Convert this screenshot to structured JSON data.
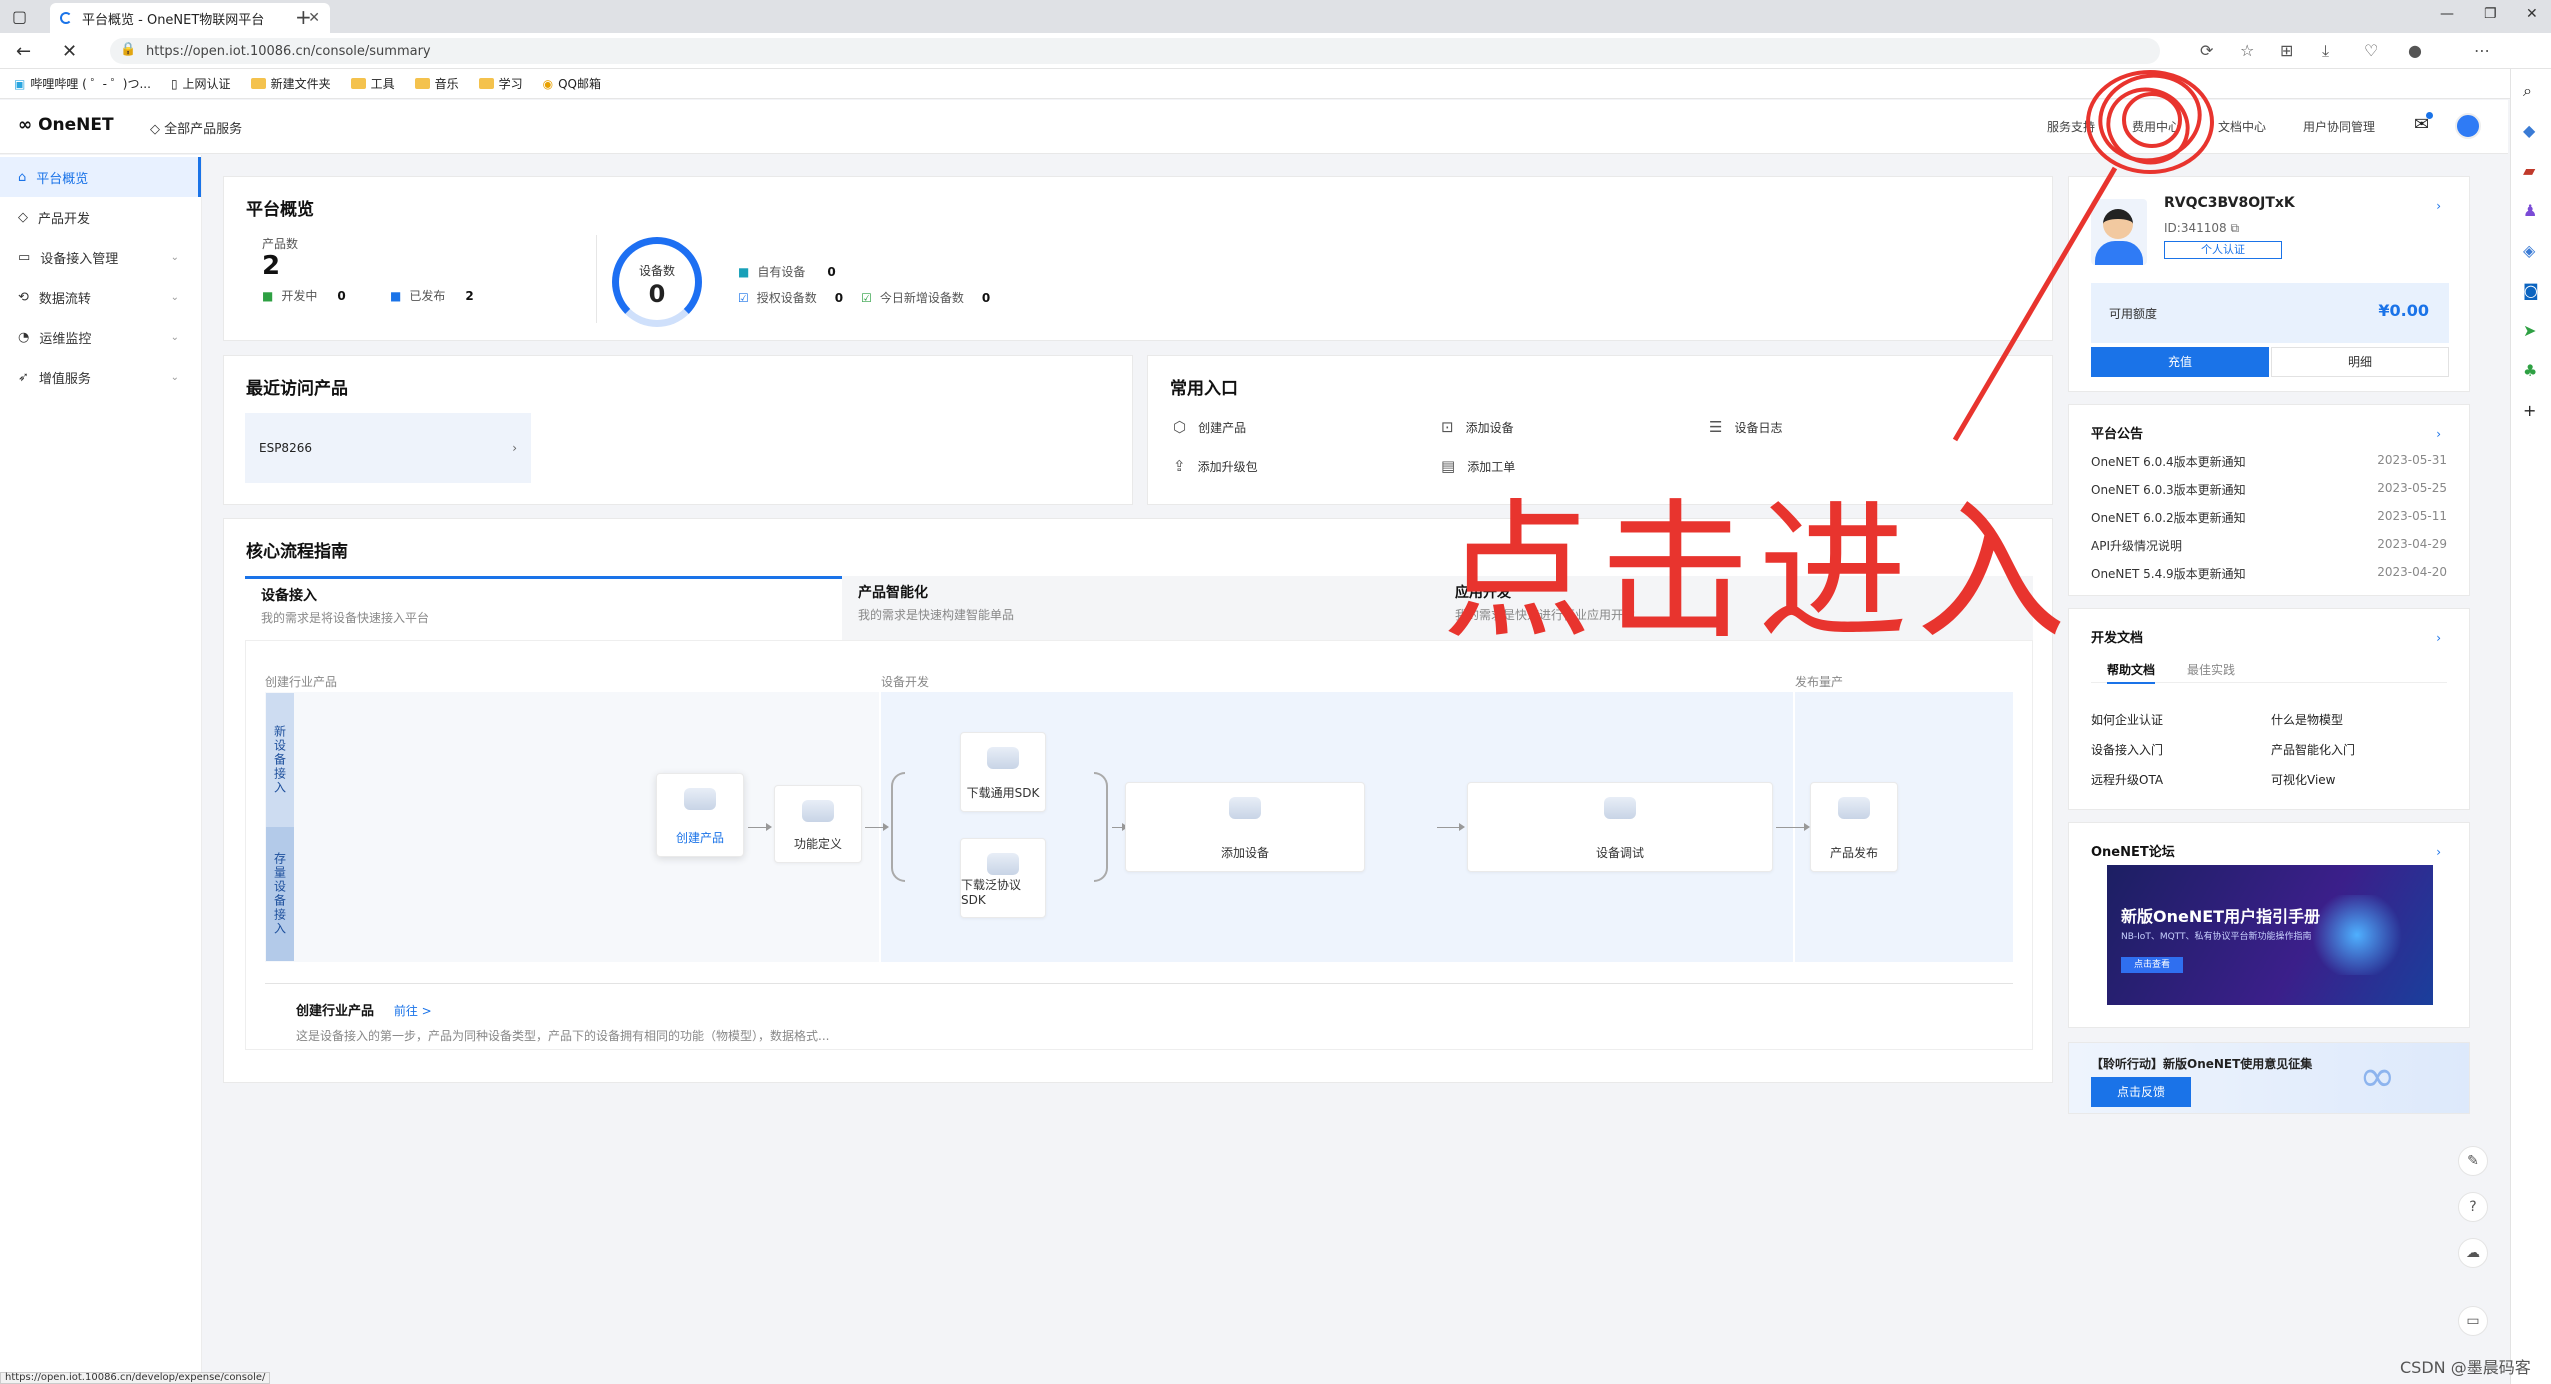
{
  "browser": {
    "tab_title": "平台概览 - OneNET物联网平台",
    "url": "https://open.iot.10086.cn/console/summary",
    "status_url": "https://open.iot.10086.cn/develop/expense/console/",
    "bookmarks": [
      "哔哩哔哩 ( ゜- ゜)つ...",
      "上网认证",
      "新建文件夹",
      "工具",
      "音乐",
      "学习",
      "QQ邮箱"
    ]
  },
  "header": {
    "logo": "OneNET",
    "all_services": "全部产品服务",
    "nav": [
      "服务支持",
      "费用中心",
      "文档中心",
      "用户协同管理"
    ]
  },
  "sidebar": {
    "items": [
      {
        "label": "平台概览"
      },
      {
        "label": "产品开发"
      },
      {
        "label": "设备接入管理"
      },
      {
        "label": "数据流转"
      },
      {
        "label": "运维监控"
      },
      {
        "label": "增值服务"
      }
    ]
  },
  "overview": {
    "title": "平台概览",
    "products_label": "产品数",
    "products_value": "2",
    "developing_label": "开发中",
    "developing_value": "0",
    "published_label": "已发布",
    "published_value": "2",
    "devices_label": "设备数",
    "devices_value": "0",
    "own_label": "自有设备",
    "own_value": "0",
    "authorized_label": "授权设备数",
    "authorized_value": "0",
    "today_label": "今日新增设备数",
    "today_value": "0"
  },
  "recent": {
    "title": "最近访问产品",
    "item": "ESP8266"
  },
  "shortcuts": {
    "title": "常用入口",
    "items": [
      "创建产品",
      "添加设备",
      "设备日志",
      "添加升级包",
      "添加工单"
    ]
  },
  "guide": {
    "title": "核心流程指南",
    "tabs": [
      {
        "title": "设备接入",
        "sub": "我的需求是将设备快速接入平台"
      },
      {
        "title": "产品智能化",
        "sub": "我的需求是快速构建智能单品"
      },
      {
        "title": "应用开发",
        "sub": "我的需求是快速进行行业应用开发"
      }
    ],
    "zones": [
      "创建行业产品",
      "设备开发",
      "发布量产"
    ],
    "strips": [
      "新设备接入",
      "存量设备接入"
    ],
    "nodes": [
      "创建产品",
      "功能定义",
      "下载通用SDK",
      "下载泛协议SDK",
      "添加设备",
      "设备调试",
      "产品发布"
    ],
    "step_title": "创建行业产品",
    "step_link": "前往 >",
    "step_desc": "这是设备接入的第一步，产品为同种设备类型，产品下的设备拥有相同的功能（物模型），数据格式..."
  },
  "account": {
    "name": "RVQC3BV8OJTxK",
    "id": "ID:341108",
    "verify": "个人认证",
    "balance_label": "可用额度",
    "balance": "¥0.00",
    "recharge": "充值",
    "detail": "明细"
  },
  "notices": {
    "title": "平台公告",
    "items": [
      {
        "t": "OneNET 6.0.4版本更新通知",
        "d": "2023-05-31"
      },
      {
        "t": "OneNET 6.0.3版本更新通知",
        "d": "2023-05-25"
      },
      {
        "t": "OneNET 6.0.2版本更新通知",
        "d": "2023-05-11"
      },
      {
        "t": "API升级情况说明",
        "d": "2023-04-29"
      },
      {
        "t": "OneNET 5.4.9版本更新通知",
        "d": "2023-04-20"
      }
    ]
  },
  "docs": {
    "title": "开发文档",
    "tabs": [
      "帮助文档",
      "最佳实践"
    ],
    "links": [
      "如何企业认证",
      "什么是物模型",
      "设备接入入门",
      "产品智能化入门",
      "远程升级OTA",
      "可视化View"
    ]
  },
  "forum": {
    "title": "OneNET论坛",
    "banner_title": "新版OneNET用户指引手册",
    "banner_sub": "NB-IoT、MQTT、私有协议平台新功能操作指南",
    "banner_btn": "点击查看"
  },
  "feedback": {
    "text": "【聆听行动】新版OneNET使用意见征集",
    "btn": "点击反馈"
  },
  "annotation": {
    "text": "点击进入",
    "color": "#e8342e"
  },
  "watermark": "CSDN @墨晨码客",
  "colors": {
    "accent": "#1a73e8"
  }
}
